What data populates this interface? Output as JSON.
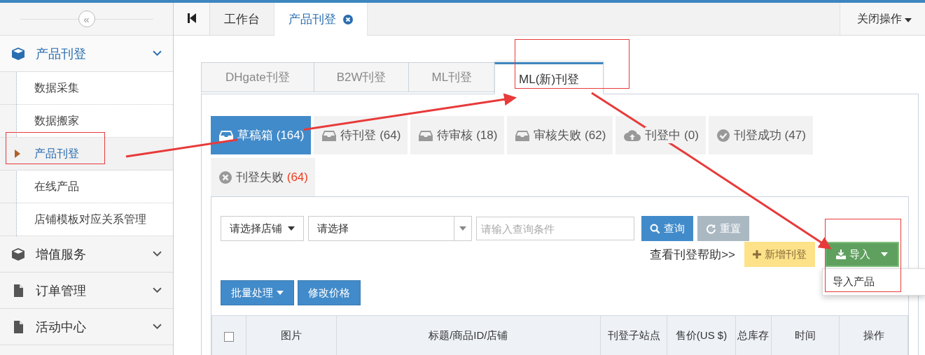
{
  "sidebar": {
    "collapse": "«",
    "groups": [
      {
        "label": "产品刊登",
        "kind": "cube",
        "expanded": true,
        "children": [
          {
            "label": "数据采集",
            "selected": false
          },
          {
            "label": "数据搬家",
            "selected": false
          },
          {
            "label": "产品刊登",
            "selected": true
          },
          {
            "label": "在线产品",
            "selected": false
          },
          {
            "label": "店铺模板对应关系管理",
            "selected": false
          }
        ]
      },
      {
        "label": "增值服务",
        "kind": "cube",
        "expanded": false
      },
      {
        "label": "订单管理",
        "kind": "file",
        "expanded": false
      },
      {
        "label": "活动中心",
        "kind": "file",
        "expanded": false
      }
    ]
  },
  "tabs": [
    {
      "label": "工作台",
      "selected": false,
      "closable": false
    },
    {
      "label": "产品刊登",
      "selected": true,
      "closable": true
    }
  ],
  "close_ops": "关闭操作",
  "platform_tabs": [
    {
      "label": "DHgate刊登",
      "selected": false
    },
    {
      "label": "B2W刊登",
      "selected": false
    },
    {
      "label": "ML刊登",
      "selected": false
    },
    {
      "label": "ML(新)刊登",
      "selected": true
    }
  ],
  "status_tabs": [
    {
      "label": "草稿箱",
      "count": "(164)",
      "kind": "inbox",
      "selected": true,
      "alert": false
    },
    {
      "label": "待刊登",
      "count": "(64)",
      "kind": "inbox",
      "selected": false,
      "alert": false
    },
    {
      "label": "待审核",
      "count": "(18)",
      "kind": "inbox",
      "selected": false,
      "alert": false
    },
    {
      "label": "审核失败",
      "count": "(62)",
      "kind": "inbox",
      "selected": false,
      "alert": false
    },
    {
      "label": "刊登中",
      "count": "(0)",
      "kind": "cloud",
      "selected": false,
      "alert": false
    },
    {
      "label": "刊登成功",
      "count": "(47)",
      "kind": "check",
      "selected": false,
      "alert": false
    },
    {
      "label": "刊登失败",
      "count": "(64)",
      "kind": "cross",
      "selected": false,
      "alert": true
    }
  ],
  "filters": {
    "shop_select": "请选择店铺",
    "select": "请选择",
    "search": {
      "placeholder": "请输入查询条件"
    },
    "query_button": "查询",
    "reset_button": "重置"
  },
  "help_link": "查看刊登帮助>>",
  "add_button": "新增刊登",
  "import_button": "导入",
  "import_menu": [
    "导入产品"
  ],
  "batch_button": "批量处理",
  "price_button": "修改价格",
  "table": {
    "select_all": {
      "checked": false
    },
    "columns": [
      "图片",
      "标题/商品ID/店铺",
      "刊登子站点",
      "售价(US $)",
      "总库存",
      "时间",
      "操作"
    ]
  }
}
